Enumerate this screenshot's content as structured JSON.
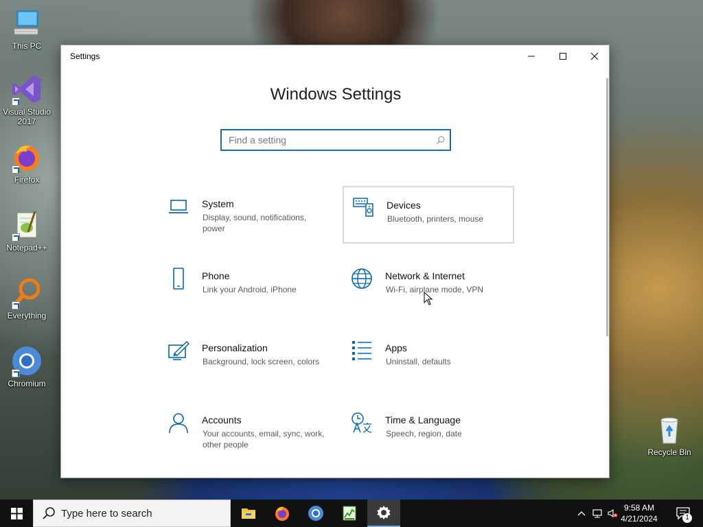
{
  "desktop": {
    "icons": [
      {
        "label": "This PC"
      },
      {
        "label": "Visual Studio 2017"
      },
      {
        "label": "Firefox"
      },
      {
        "label": "Notepad++"
      },
      {
        "label": "Everything"
      },
      {
        "label": "Chromium"
      },
      {
        "label": "Recycle Bin"
      }
    ]
  },
  "window": {
    "title": "Settings",
    "heading": "Windows Settings",
    "search": {
      "placeholder": "Find a setting",
      "value": ""
    },
    "tiles": [
      {
        "name": "System",
        "desc": "Display, sound, notifications, power",
        "icon": "laptop-icon"
      },
      {
        "name": "Devices",
        "desc": "Bluetooth, printers, mouse",
        "icon": "devices-icon"
      },
      {
        "name": "Phone",
        "desc": "Link your Android, iPhone",
        "icon": "phone-icon"
      },
      {
        "name": "Network & Internet",
        "desc": "Wi-Fi, airplane mode, VPN",
        "icon": "globe-icon"
      },
      {
        "name": "Personalization",
        "desc": "Background, lock screen, colors",
        "icon": "paint-icon"
      },
      {
        "name": "Apps",
        "desc": "Uninstall, defaults",
        "icon": "apps-list-icon"
      },
      {
        "name": "Accounts",
        "desc": "Your accounts, email, sync, work, other people",
        "icon": "person-icon"
      },
      {
        "name": "Time & Language",
        "desc": "Speech, region, date",
        "icon": "time-language-icon"
      }
    ],
    "hovered_tile": "Devices"
  },
  "taskbar": {
    "search_placeholder": "Type here to search",
    "time": "9:58 AM",
    "date": "4/21/2024",
    "notification_count": "1",
    "apps": [
      "file-explorer-icon",
      "firefox-icon",
      "chromium-icon",
      "task-manager-icon",
      "settings-gear-icon"
    ]
  },
  "colors": {
    "accent": "#0067b8",
    "search_border": "#1a6fa8",
    "taskbar": "#101010"
  }
}
